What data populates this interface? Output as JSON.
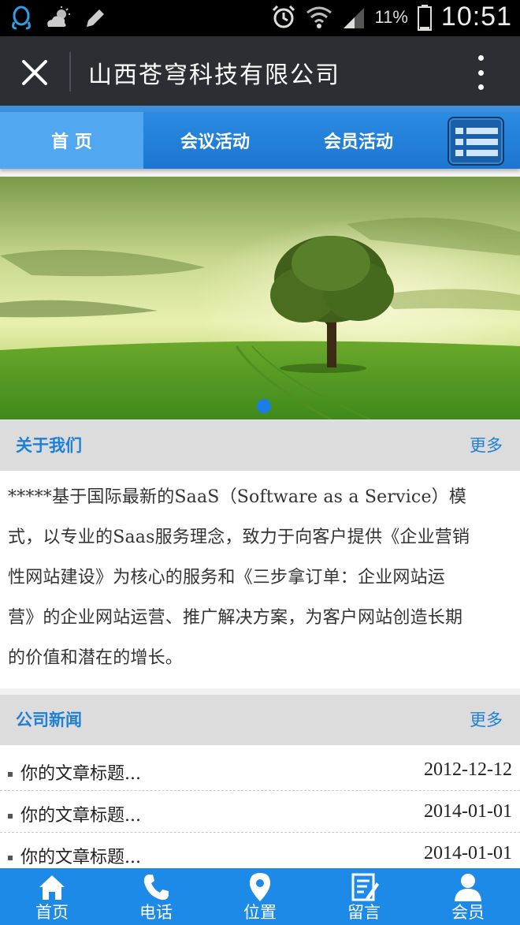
{
  "status_bar": {
    "battery_percent": "11%",
    "time": "10:51"
  },
  "title_bar": {
    "title": "山西苍穹科技有限公司"
  },
  "nav": {
    "tabs": [
      {
        "label": "首 页",
        "active": true
      },
      {
        "label": "会议活动",
        "active": false
      },
      {
        "label": "会员活动",
        "active": false
      }
    ]
  },
  "banner": {
    "slide_count": 1,
    "active_slide": 1
  },
  "about": {
    "title": "关于我们",
    "more": "更多",
    "lines": [
      "*****基于国际最新的SaaS（Software as a Service）模",
      "式，以专业的Saas服务理念，致力于向客户提供《企业营销",
      "性网站建设》为核心的服务和《三步拿订单：企业网站运",
      "营》的企业网站运营、推广解决方案，为客户网站创造长期",
      "的价值和潜在的增长。"
    ]
  },
  "news": {
    "title": "公司新闻",
    "more": "更多",
    "items": [
      {
        "title": "你的文章标题...",
        "date": "2012-12-12"
      },
      {
        "title": "你的文章标题...",
        "date": "2014-01-01"
      },
      {
        "title": "你的文章标题...",
        "date": "2014-01-01"
      }
    ]
  },
  "bottom_bar": {
    "items": [
      {
        "label": "首页",
        "icon": "home-icon"
      },
      {
        "label": "电话",
        "icon": "phone-icon"
      },
      {
        "label": "位置",
        "icon": "location-icon"
      },
      {
        "label": "留言",
        "icon": "message-icon"
      },
      {
        "label": "会员",
        "icon": "member-icon"
      }
    ]
  },
  "colors": {
    "accent": "#1e7fd6",
    "nav": "#2b8be2",
    "titlebar": "#2b2f33"
  }
}
